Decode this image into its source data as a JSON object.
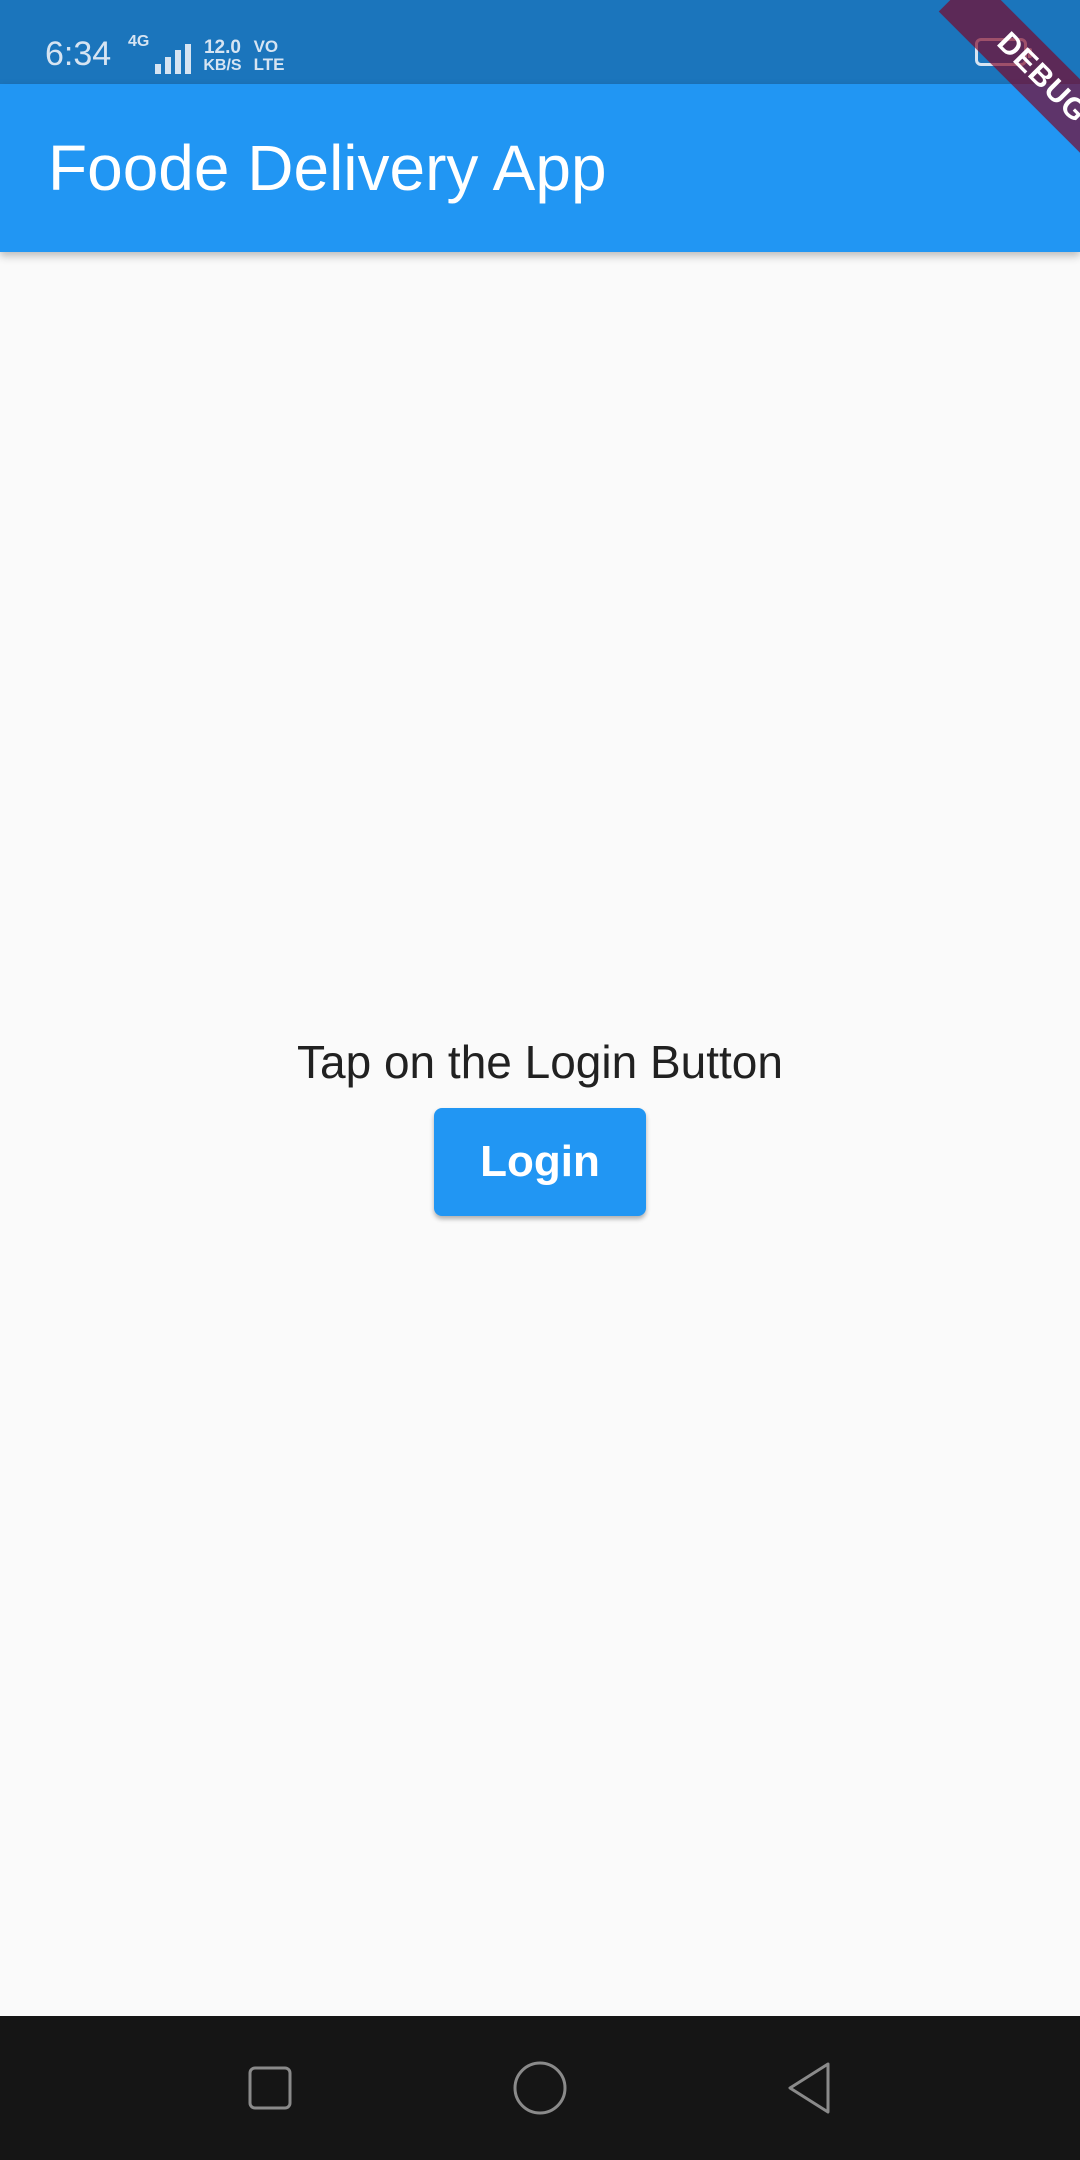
{
  "status_bar": {
    "time": "6:34",
    "network_type": "4G",
    "speed_value": "12.0",
    "speed_unit": "KB/S",
    "volte_top": "VO",
    "volte_bottom": "LTE",
    "signal_icon": "signal-bars-icon",
    "battery_icon": "battery-icon"
  },
  "app_bar": {
    "title": "Foode Delivery App"
  },
  "debug_banner": {
    "label": "DEBUG"
  },
  "main": {
    "prompt": "Tap on the Login Button",
    "login_button_label": "Login"
  },
  "nav_bar": {
    "recents_icon": "square-recents-icon",
    "home_icon": "circle-home-icon",
    "back_icon": "triangle-back-icon"
  },
  "colors": {
    "status_bar": "#1b75bc",
    "app_bar": "#2196f3",
    "button": "#2196f3",
    "background": "#fafafa",
    "nav_bar": "#151515",
    "debug_ribbon": "#800020"
  }
}
